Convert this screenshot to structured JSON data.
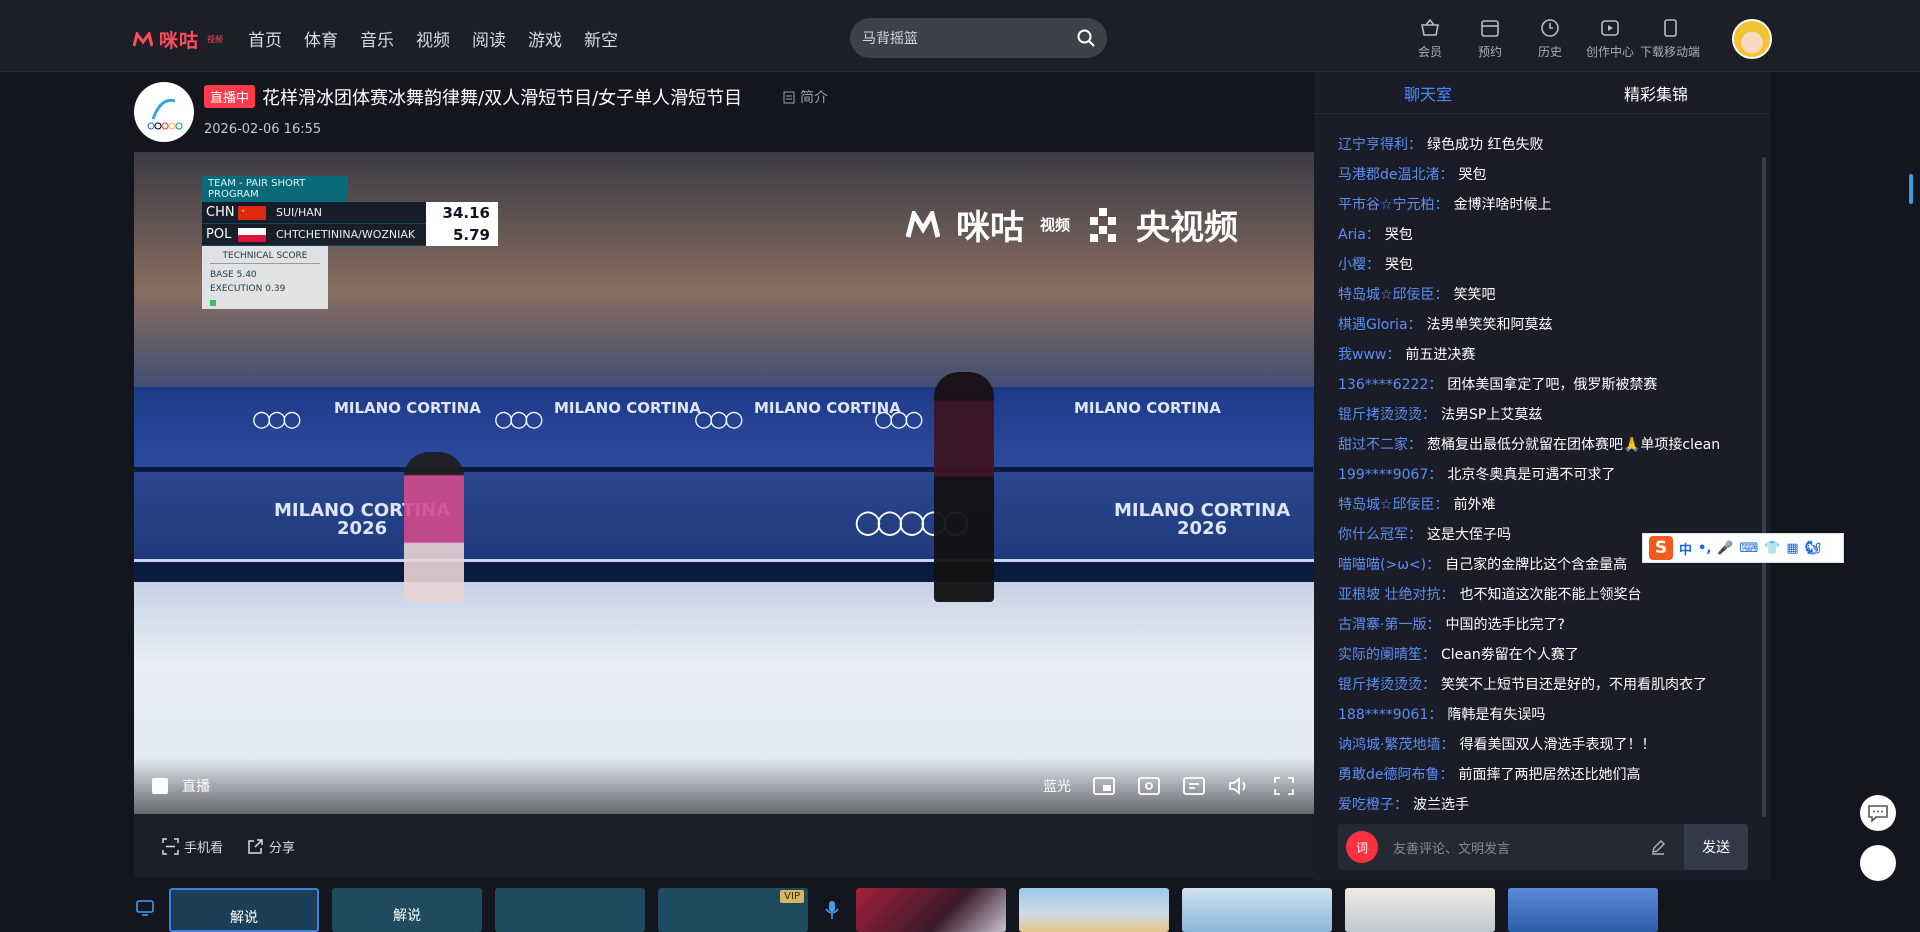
{
  "header": {
    "logo_text": "咪咕",
    "logo_sub": "视频",
    "nav": [
      "首页",
      "体育",
      "音乐",
      "视频",
      "阅读",
      "游戏",
      "新空"
    ],
    "search_value": "马背摇篮",
    "tools": [
      {
        "label": "会员",
        "icon": "vip-basket-icon"
      },
      {
        "label": "预约",
        "icon": "calendar-icon"
      },
      {
        "label": "历史",
        "icon": "clock-icon"
      },
      {
        "label": "创作中心",
        "icon": "creator-icon"
      },
      {
        "label": "下载移动端",
        "icon": "mobile-download-icon"
      }
    ]
  },
  "video": {
    "live_badge": "直播中",
    "title": "花样滑冰团体赛冰舞韵律舞/双人滑短节目/女子单人滑短节目",
    "intro_label": "简介",
    "date": "2026-02-06 16:55"
  },
  "scoreboard": {
    "header": "TEAM - PAIR SHORT PROGRAM",
    "rows": [
      {
        "country": "CHN",
        "names": "SUI/HAN",
        "score": "34.16",
        "flag_color": "#de2910"
      },
      {
        "country": "POL",
        "names": "CHTCHETININA/WOZNIAK",
        "score": "5.79",
        "flag_color": "#dc143c"
      }
    ],
    "tech_title": "TECHNICAL SCORE",
    "base_label": "BASE",
    "base_value": "5.40",
    "exec_label": "EXECUTION",
    "exec_value": "0.39"
  },
  "watermark": {
    "brand1": "咪咕",
    "brand1_sub": "视频",
    "brand2": "央视频"
  },
  "arena": {
    "board_text": "MILANO CORTINA",
    "board_year": "2026"
  },
  "player": {
    "live_label": "直播",
    "quality": "蓝光"
  },
  "actions": {
    "mobile_watch": "手机看",
    "share": "分享"
  },
  "strip": {
    "cards": [
      {
        "label": "解说",
        "selected": true
      },
      {
        "label": "解说",
        "selected": false
      },
      {
        "label": "",
        "selected": false
      },
      {
        "label": "",
        "selected": false,
        "vip": "VIP"
      }
    ]
  },
  "chat": {
    "tabs": [
      "聊天室",
      "精彩集锦"
    ],
    "messages": [
      {
        "user": "辽宁亨得利：",
        "text": "绿色成功 红色失败"
      },
      {
        "user": "马港郡de温北渚：",
        "text": "哭包"
      },
      {
        "user": "平市谷☆宁元柏：",
        "text": "金博洋啥时候上"
      },
      {
        "user": "Aria：",
        "text": "哭包"
      },
      {
        "user": "小樱：",
        "text": "哭包"
      },
      {
        "user": "特岛城☆邱佞臣：",
        "text": "笑笑吧"
      },
      {
        "user": "棋遇Gloria：",
        "text": "法男单笑笑和阿莫兹"
      },
      {
        "user": "我www：",
        "text": "前五进决赛"
      },
      {
        "user": "136****6222：",
        "text": "团体美国拿定了吧，俄罗斯被禁赛"
      },
      {
        "user": "锟斤拷烫烫烫：",
        "text": "法男SP上艾莫兹"
      },
      {
        "user": "甜过不二家：",
        "text": "葱桶复出最低分就留在团体赛吧🙏单项接clean"
      },
      {
        "user": "199****9067：",
        "text": "北京冬奥真是可遇不可求了"
      },
      {
        "user": "特岛城☆邱佞臣：",
        "text": "前外难"
      },
      {
        "user": "你什么冠军：",
        "text": "这是大侄子吗"
      },
      {
        "user": "喵喵喵(>ω<)：",
        "text": "自己家的金牌比这个含金量高"
      },
      {
        "user": "亚根坡 壮绝对抗：",
        "text": "也不知道这次能不能上领奖台"
      },
      {
        "user": "古渭寨·第一版：",
        "text": "中国的选手比完了?"
      },
      {
        "user": "实际的阑晴笙：",
        "text": "Clean劵留在个人赛了"
      },
      {
        "user": "锟斤拷烫烫烫：",
        "text": "笑笑不上短节目还是好的，不用看肌肉衣了"
      },
      {
        "user": "188****9061：",
        "text": "隋韩是有失误吗"
      },
      {
        "user": "讷鸿城·繁茂地墙：",
        "text": "得看美国双人滑选手表现了！！"
      },
      {
        "user": "勇敢de德阿布鲁：",
        "text": "前面摔了两把居然还比她们高"
      },
      {
        "user": "爱吃橙子：",
        "text": "波兰选手"
      }
    ],
    "composer_badge": "词",
    "composer_placeholder": "友善评论、文明发言",
    "send_label": "发送"
  },
  "ime": {
    "logo": "S",
    "lang": "中"
  },
  "colors": {
    "accent": "#4a8cff",
    "live": "#ff3a4a",
    "brand": "#ff4b5c"
  }
}
